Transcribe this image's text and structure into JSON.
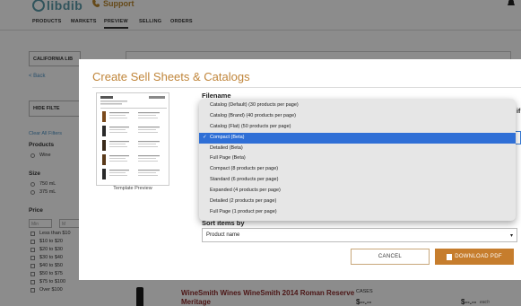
{
  "app": {
    "logo_text": "libdib",
    "support_label": "Support"
  },
  "nav": {
    "items": [
      "PRODUCTS",
      "MARKETS",
      "PREVIEW",
      "SELLING",
      "ORDERS"
    ],
    "active": "PREVIEW"
  },
  "sidebar": {
    "state_select": "CALIFORNIA LIB",
    "back_label": "< Back",
    "hide_filters_label": "HIDE FILTE",
    "clear_filters_label": "Clear All Filters",
    "products_heading": "Products",
    "products_options": [
      "Wine"
    ],
    "size_heading": "Size",
    "size_options": [
      "750 mL",
      "375 mL"
    ],
    "price_heading": "Price",
    "price_min_placeholder": "Min",
    "price_max_placeholder": "M",
    "price_options": [
      "Less than $10",
      "$10 to $20",
      "$20 to $30",
      "$30 to $40",
      "$40 to $50",
      "$50 to $75",
      "$75 to $100",
      "Over $100"
    ]
  },
  "product_card": {
    "title": "WineSmith Wines WineSmith 2014 Roman Reserve Meritage",
    "cases_label": "CASES",
    "price_case": "$--.--",
    "price_each": "$--.--",
    "each_label": "each"
  },
  "modal": {
    "title": "Create Sell Sheets & Catalogs",
    "preview_caption": "Template Preview",
    "filename_label": "Filename",
    "right_cut_label": "if",
    "sort_label": "Sort items by",
    "sort_value": "Product name",
    "cancel_label": "CANCEL",
    "download_label": "DOWNLOAD PDF"
  },
  "template_dropdown": {
    "options": [
      "Catalog (Default) (30 products per page)",
      "Catalog (Brand) (40 products per page)",
      "Catalog (Flat) (50 products per page)",
      "Compact (Beta)",
      "Detailed (Beta)",
      "Full Page (Beta)",
      "Compact (8 products per page)",
      "Standard (6 products per page)",
      "Expanded (4 products per page)",
      "Detailed (2 products per page)",
      "Full Page (1 product per page)"
    ],
    "selected_index": 3,
    "check_mark": "✓"
  },
  "colors": {
    "accent": "#c0853a",
    "download_button": "#c67d2d",
    "selected_item": "#2f6fd6",
    "product_title": "#8b2a2a",
    "link": "#4a90c2"
  }
}
